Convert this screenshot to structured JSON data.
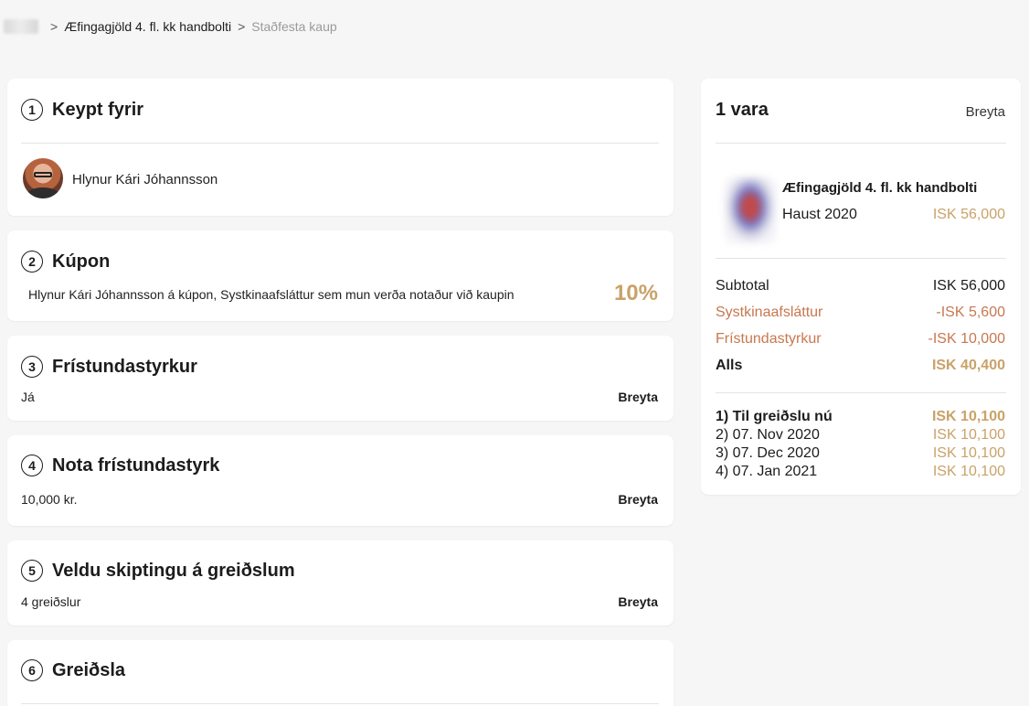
{
  "breadcrumb": {
    "item": "Æfingagjöld 4. fl. kk handbolti",
    "current": "Staðfesta kaup",
    "separator": ">"
  },
  "steps": [
    {
      "num": "1",
      "title": "Keypt fyrir",
      "person": "Hlynur Kári Jóhannsson"
    },
    {
      "num": "2",
      "title": "Kúpon",
      "text": "Hlynur Kári Jóhannsson á kúpon, Systkinaafsláttur sem mun verða notaður við kaupin",
      "badge": "10%"
    },
    {
      "num": "3",
      "title": "Frístundastyrkur",
      "value": "Já",
      "edit": "Breyta"
    },
    {
      "num": "4",
      "title": "Nota frístundastyrk",
      "value": "10,000 kr.",
      "edit": "Breyta"
    },
    {
      "num": "5",
      "title": "Veldu skiptingu á greiðslum",
      "value": "4 greiðslur",
      "edit": "Breyta"
    },
    {
      "num": "6",
      "title": "Greiðsla"
    }
  ],
  "summary": {
    "title": "1 vara",
    "edit": "Breyta",
    "product": {
      "name": "Æfingagjöld 4. fl. kk handbolti",
      "season": "Haust 2020",
      "price": "ISK 56,000"
    },
    "lines": [
      {
        "label": "Subtotal",
        "amount": "ISK 56,000"
      },
      {
        "label": "Systkinaafsláttur",
        "amount": "-ISK 5,600"
      },
      {
        "label": "Frístundastyrkur",
        "amount": "-ISK 10,000"
      },
      {
        "label": "Alls",
        "amount": "ISK 40,400"
      }
    ],
    "installments": [
      {
        "label": "1) Til greiðslu nú",
        "amount": "ISK 10,100"
      },
      {
        "label": "2) 07. Nov 2020",
        "amount": "ISK 10,100"
      },
      {
        "label": "3) 07. Dec 2020",
        "amount": "ISK 10,100"
      },
      {
        "label": "4) 07. Jan 2021",
        "amount": "ISK 10,100"
      }
    ]
  },
  "colors": {
    "accent_gold": "#c9a268",
    "discount_orange": "#c7784f",
    "background": "#f6f6f6"
  }
}
